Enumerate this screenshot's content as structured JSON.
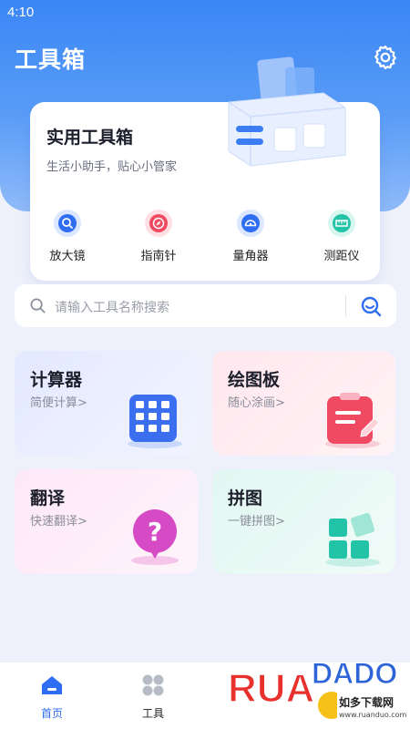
{
  "status_bar": {
    "time": "4:10"
  },
  "header": {
    "title": "工具箱",
    "settings_icon": "gear-icon"
  },
  "card": {
    "title": "实用工具箱",
    "subtitle": "生活小助手，贴心小管家",
    "quick_tools": [
      {
        "label": "放大镜",
        "icon": "magnifier-icon",
        "color": "#2f6df2"
      },
      {
        "label": "指南针",
        "icon": "compass-icon",
        "color": "#f04a62"
      },
      {
        "label": "量角器",
        "icon": "protractor-icon",
        "color": "#2f6df2"
      },
      {
        "label": "测距仪",
        "icon": "ruler-icon",
        "color": "#22c3a6"
      }
    ]
  },
  "search": {
    "placeholder": "请输入工具名称搜索"
  },
  "tiles": [
    {
      "title": "计算器",
      "subtitle": "简便计算>",
      "icon": "calculator-icon"
    },
    {
      "title": "绘图板",
      "subtitle": "随心涂画>",
      "icon": "clipboard-pen-icon"
    },
    {
      "title": "翻译",
      "subtitle": "快速翻译>",
      "icon": "question-bubble-icon"
    },
    {
      "title": "拼图",
      "subtitle": "一键拼图>",
      "icon": "puzzle-blocks-icon"
    }
  ],
  "tabbar": {
    "items": [
      {
        "label": "首页",
        "icon": "home-icon",
        "active": true
      },
      {
        "label": "工具",
        "icon": "grid-icon",
        "active": false
      }
    ]
  },
  "watermark": {
    "brand": "RUANDADO",
    "text": "如多下载网",
    "url": "www.ruanduo.com"
  },
  "colors": {
    "primary": "#2f6df2",
    "hero": "#3a86f5",
    "background": "#eef1fb"
  }
}
